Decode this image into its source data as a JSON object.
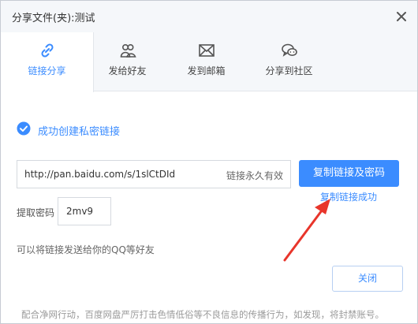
{
  "window": {
    "title": "分享文件(夹):测试",
    "close_icon": "close-icon"
  },
  "tabs": [
    {
      "label": "链接分享",
      "icon": "link-icon",
      "active": true
    },
    {
      "label": "发给好友",
      "icon": "friends-icon",
      "active": false
    },
    {
      "label": "发到邮箱",
      "icon": "mail-icon",
      "active": false
    },
    {
      "label": "分享到社区",
      "icon": "chat-bubbles-icon",
      "active": false
    }
  ],
  "main": {
    "success_message": "成功创建私密链接",
    "link_url": "http://pan.baidu.com/s/1slCtDId",
    "link_expiry": "链接永久有效",
    "copy_button_label": "复制链接及密码",
    "copy_success_text": "复制链接成功",
    "password_label": "提取密码",
    "password_value": "2mv9",
    "hint_text": "可以将链接发送给你的QQ等好友",
    "close_button_label": "关闭",
    "notice_text": "配合净网行动，百度网盘严厉打击色情低俗等不良信息的传播行为，如发现，将封禁账号。"
  },
  "colors": {
    "accent": "#3b8cff",
    "annotation_arrow": "#e8352b"
  }
}
